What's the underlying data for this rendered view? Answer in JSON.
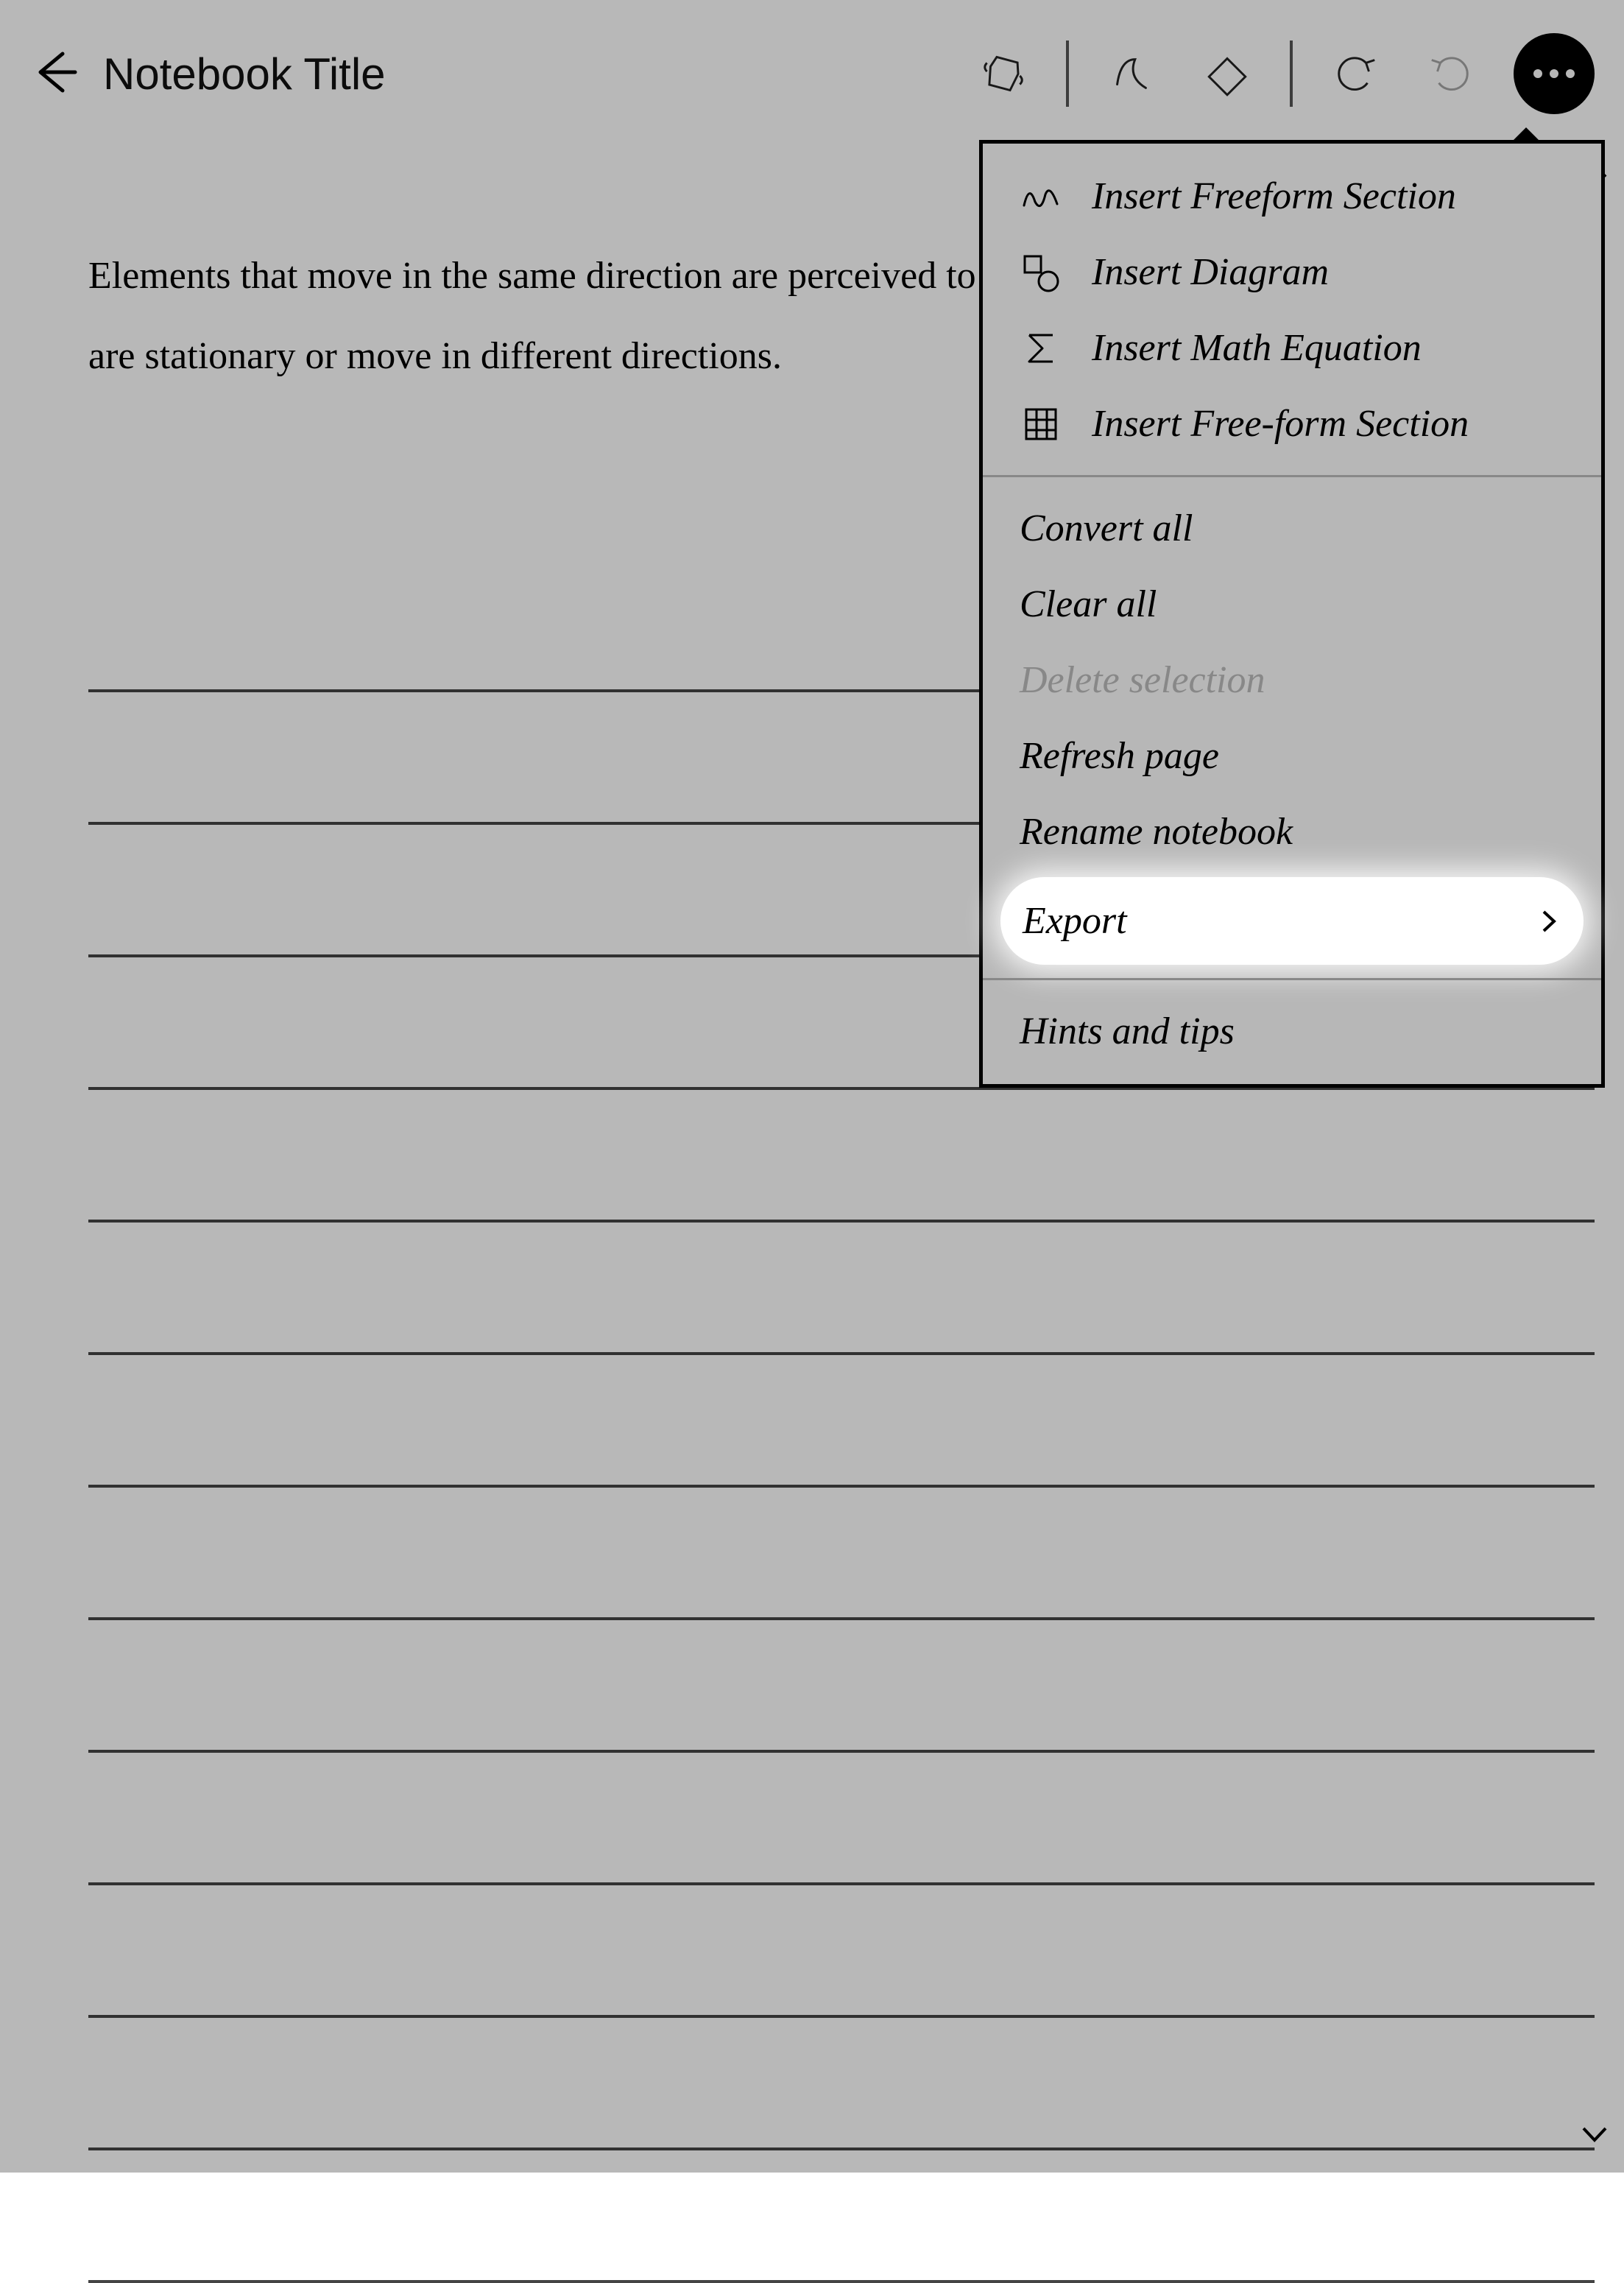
{
  "toolbar": {
    "title": "Notebook Title"
  },
  "body_text": "Elements that move in the same direction are perceived to be more related than elements that are stationary or move in different directions.",
  "menu": {
    "insert_freeform": "Insert Freeform Section",
    "insert_diagram": "Insert Diagram",
    "insert_math": "Insert Math Equation",
    "insert_freeform2": "Insert Free-form Section",
    "convert_all": "Convert all",
    "clear_all": "Clear all",
    "delete_selection": "Delete selection",
    "refresh_page": "Refresh page",
    "rename_notebook": "Rename notebook",
    "export": "Export",
    "hints": "Hints and tips"
  }
}
